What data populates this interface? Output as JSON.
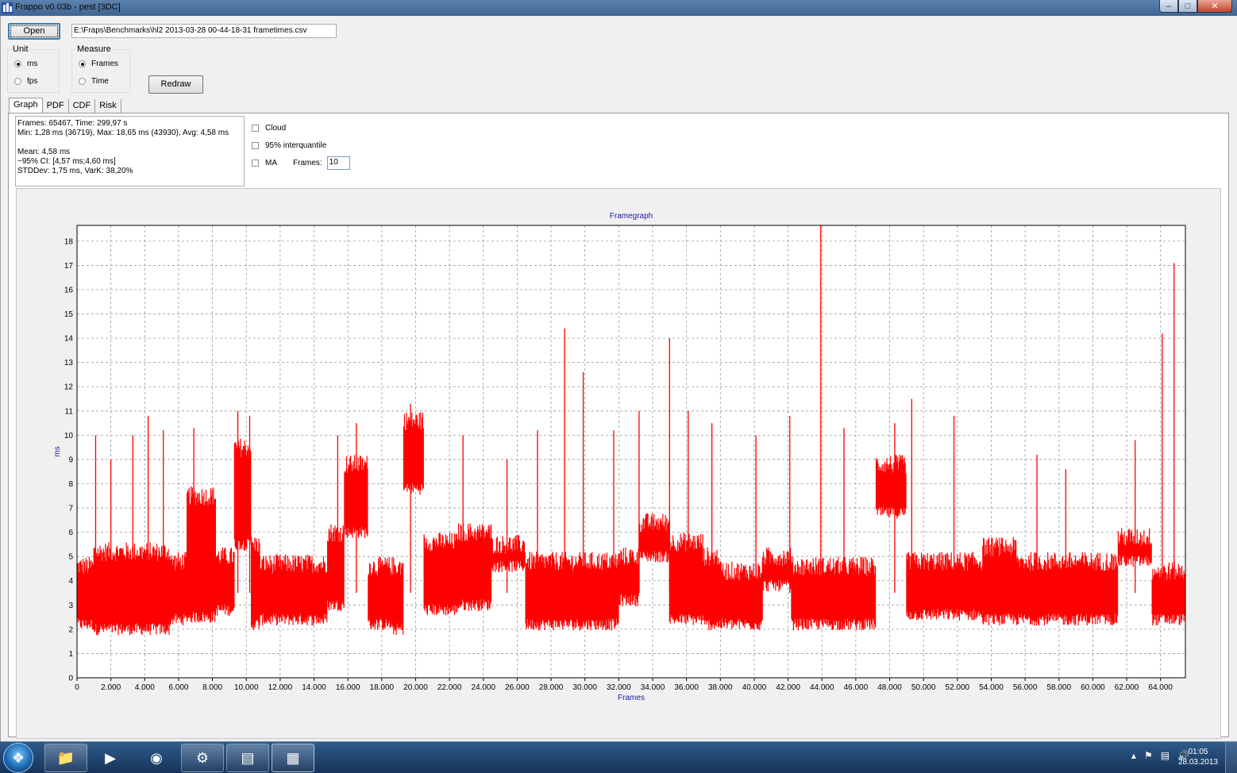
{
  "window": {
    "title": "Frappo v0.03b - pest [3DC]"
  },
  "toolbar": {
    "open_label": "Open",
    "file_path": "E:\\Fraps\\Benchmarks\\hl2 2013-03-28 00-44-18-31 frametimes.csv"
  },
  "unit_group": {
    "label": "Unit",
    "options": [
      "ms",
      "fps"
    ],
    "selected": "ms"
  },
  "measure_group": {
    "label": "Measure",
    "options": [
      "Frames",
      "Time"
    ],
    "selected": "Frames"
  },
  "redraw_label": "Redraw",
  "tabs": [
    "Graph",
    "PDF",
    "CDF",
    "Risk"
  ],
  "active_tab": "Graph",
  "stats": {
    "line1": "Frames: 65467, Time: 299,97 s",
    "line2": "Min: 1,28 ms (36719), Max: 18,65 ms (43930), Avg: 4,58 ms",
    "line3": "Mean: 4,58 ms",
    "line4": "~95% CI: [4,57 ms;4,60 ms]",
    "line5": "STDDev: 1,75 ms, VarK: 38,20%"
  },
  "options": {
    "cloud_label": "Cloud",
    "interquantile_label": "95% interquantile",
    "ma_label": "MA",
    "frames_label": "Frames:",
    "frames_value": "10"
  },
  "chart_data": {
    "type": "line",
    "title": "Framegraph",
    "xlabel": "Frames",
    "ylabel": "ms",
    "xlim": [
      0,
      65467
    ],
    "ylim": [
      0,
      18.65
    ],
    "grid": true,
    "line_color": "#ff0000",
    "x_ticks": [
      "0",
      "2.000",
      "4.000",
      "6.000",
      "8.000",
      "10.000",
      "12.000",
      "14.000",
      "16.000",
      "18.000",
      "20.000",
      "22.000",
      "24.000",
      "26.000",
      "28.000",
      "30.000",
      "32.000",
      "34.000",
      "36.000",
      "38.000",
      "40.000",
      "42.000",
      "44.000",
      "46.000",
      "48.000",
      "50.000",
      "52.000",
      "54.000",
      "56.000",
      "58.000",
      "60.000",
      "62.000",
      "64.000"
    ],
    "y_ticks": [
      "0",
      "1",
      "2",
      "3",
      "4",
      "5",
      "6",
      "7",
      "8",
      "9",
      "10",
      "11",
      "12",
      "13",
      "14",
      "15",
      "16",
      "17",
      "18"
    ],
    "series": [
      {
        "segments": [
          {
            "x0": 0,
            "x1": 1000,
            "lo": 2.2,
            "hi": 4.6
          },
          {
            "x0": 1000,
            "x1": 5500,
            "lo": 2.0,
            "hi": 5.2
          },
          {
            "x0": 5500,
            "x1": 6500,
            "lo": 2.4,
            "hi": 4.8
          },
          {
            "x0": 6500,
            "x1": 8200,
            "lo": 2.5,
            "hi": 7.5
          },
          {
            "x0": 8200,
            "x1": 9300,
            "lo": 2.8,
            "hi": 5.0
          },
          {
            "x0": 9300,
            "x1": 10300,
            "lo": 5.5,
            "hi": 9.5
          },
          {
            "x0": 10300,
            "x1": 10800,
            "lo": 2.2,
            "hi": 5.5
          },
          {
            "x0": 10800,
            "x1": 14800,
            "lo": 2.4,
            "hi": 4.7
          },
          {
            "x0": 14800,
            "x1": 15800,
            "lo": 3.0,
            "hi": 6.0
          },
          {
            "x0": 15800,
            "x1": 17200,
            "lo": 6.0,
            "hi": 8.8
          },
          {
            "x0": 17200,
            "x1": 18500,
            "lo": 2.2,
            "hi": 4.6
          },
          {
            "x0": 18500,
            "x1": 19300,
            "lo": 2.0,
            "hi": 4.6
          },
          {
            "x0": 19300,
            "x1": 20500,
            "lo": 7.8,
            "hi": 10.6
          },
          {
            "x0": 20500,
            "x1": 22500,
            "lo": 2.8,
            "hi": 5.6
          },
          {
            "x0": 22500,
            "x1": 24500,
            "lo": 3.0,
            "hi": 6.0
          },
          {
            "x0": 24500,
            "x1": 26500,
            "lo": 4.6,
            "hi": 5.5
          },
          {
            "x0": 26500,
            "x1": 32000,
            "lo": 2.2,
            "hi": 4.8
          },
          {
            "x0": 32000,
            "x1": 33200,
            "lo": 3.2,
            "hi": 5.0
          },
          {
            "x0": 33200,
            "x1": 35000,
            "lo": 5.0,
            "hi": 6.4
          },
          {
            "x0": 35000,
            "x1": 37000,
            "lo": 2.4,
            "hi": 5.6
          },
          {
            "x0": 37000,
            "x1": 38000,
            "lo": 2.2,
            "hi": 5.0
          },
          {
            "x0": 38000,
            "x1": 40500,
            "lo": 2.2,
            "hi": 4.4
          },
          {
            "x0": 40500,
            "x1": 42200,
            "lo": 3.8,
            "hi": 5.0
          },
          {
            "x0": 42200,
            "x1": 47200,
            "lo": 2.2,
            "hi": 4.6
          },
          {
            "x0": 47200,
            "x1": 49000,
            "lo": 6.8,
            "hi": 8.8
          },
          {
            "x0": 49000,
            "x1": 53500,
            "lo": 2.6,
            "hi": 4.8
          },
          {
            "x0": 53500,
            "x1": 55500,
            "lo": 2.4,
            "hi": 5.4
          },
          {
            "x0": 55500,
            "x1": 61500,
            "lo": 2.4,
            "hi": 4.8
          },
          {
            "x0": 61500,
            "x1": 63500,
            "lo": 4.8,
            "hi": 5.8
          },
          {
            "x0": 63500,
            "x1": 65467,
            "lo": 2.4,
            "hi": 4.4
          }
        ],
        "spikes": [
          {
            "x": 1100,
            "y": 10.0
          },
          {
            "x": 2000,
            "y": 9.0
          },
          {
            "x": 3300,
            "y": 10.0
          },
          {
            "x": 4200,
            "y": 10.8
          },
          {
            "x": 5100,
            "y": 10.2
          },
          {
            "x": 6900,
            "y": 10.3
          },
          {
            "x": 9500,
            "y": 11.0
          },
          {
            "x": 10200,
            "y": 10.8
          },
          {
            "x": 15400,
            "y": 10.0
          },
          {
            "x": 16500,
            "y": 10.5
          },
          {
            "x": 19700,
            "y": 11.3
          },
          {
            "x": 22800,
            "y": 10.0
          },
          {
            "x": 25400,
            "y": 9.0
          },
          {
            "x": 27200,
            "y": 10.2
          },
          {
            "x": 28800,
            "y": 14.4
          },
          {
            "x": 29900,
            "y": 12.6
          },
          {
            "x": 31700,
            "y": 10.2
          },
          {
            "x": 33200,
            "y": 11.0
          },
          {
            "x": 35000,
            "y": 14.0
          },
          {
            "x": 36100,
            "y": 11.0
          },
          {
            "x": 37500,
            "y": 10.5
          },
          {
            "x": 40100,
            "y": 10.0
          },
          {
            "x": 42100,
            "y": 10.8
          },
          {
            "x": 43930,
            "y": 18.65
          },
          {
            "x": 45300,
            "y": 10.3
          },
          {
            "x": 48300,
            "y": 10.5
          },
          {
            "x": 49300,
            "y": 11.5
          },
          {
            "x": 51800,
            "y": 10.8
          },
          {
            "x": 56700,
            "y": 9.2
          },
          {
            "x": 58400,
            "y": 8.6
          },
          {
            "x": 62500,
            "y": 9.8
          },
          {
            "x": 64100,
            "y": 14.2
          },
          {
            "x": 64800,
            "y": 17.1
          }
        ]
      }
    ]
  },
  "taskbar": {
    "clock_time": "01:05",
    "clock_date": "28.03.2013"
  }
}
